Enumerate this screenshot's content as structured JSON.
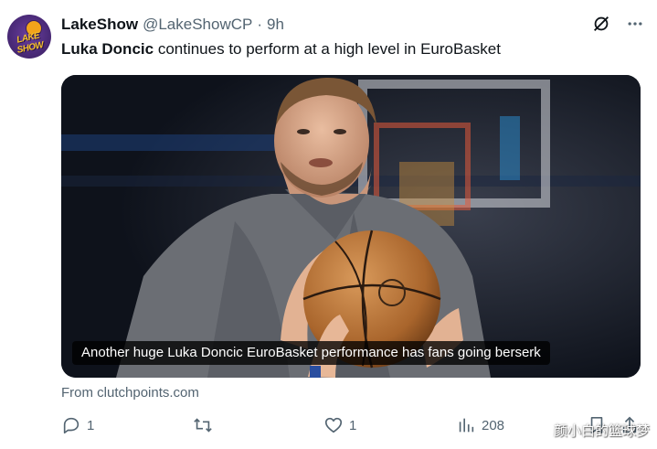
{
  "tweet": {
    "display_name": "LakeShow",
    "handle": "@LakeShowCP",
    "separator": "·",
    "time": "9h",
    "text_bold": "Luka Doncic",
    "text_rest": " continues to perform at a high level in EuroBasket",
    "avatar_text": "LAKE SHOW"
  },
  "card": {
    "caption": "Another huge Luka Doncic EuroBasket performance has fans going berserk",
    "source": "From clutchpoints.com"
  },
  "actions": {
    "reply_count": "1",
    "repost_count": "",
    "like_count": "1",
    "views_count": "208"
  },
  "watermark": "颜小白的篮球梦",
  "icons": {
    "grok": "slashed-circle-icon",
    "more": "more-dots-icon",
    "reply": "comment-icon",
    "repost": "repost-icon",
    "like": "heart-icon",
    "views": "analytics-icon",
    "bookmark": "bookmark-icon",
    "share": "share-icon"
  },
  "colors": {
    "text": "#0f1419",
    "muted": "#536471",
    "caption_bg": "#000000",
    "avatar": "#4a2a78",
    "avatar_accent": "#f7c12b"
  }
}
